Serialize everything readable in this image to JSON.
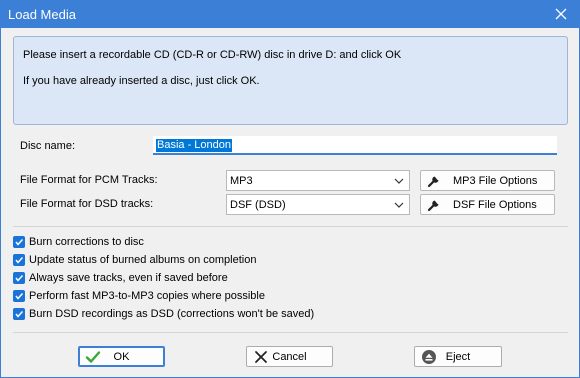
{
  "window": {
    "title": "Load Media",
    "accent_color": "#3b7fd6"
  },
  "info": {
    "line1": "Please insert a recordable CD (CD-R or CD-RW) disc in drive D: and click OK",
    "line2": "If you have already inserted a disc, just click OK."
  },
  "disc": {
    "label": "Disc name:",
    "value": "Basia - London"
  },
  "pcm": {
    "label": "File Format for PCM Tracks:",
    "selected": "MP3",
    "options_button": "MP3 File Options"
  },
  "dsd": {
    "label": "File Format for DSD tracks:",
    "selected": "DSF (DSD)",
    "options_button": "DSF File Options"
  },
  "checkboxes": [
    {
      "label": "Burn corrections to disc",
      "checked": true
    },
    {
      "label": "Update status of burned albums on completion",
      "checked": true
    },
    {
      "label": "Always save tracks, even if saved before",
      "checked": true
    },
    {
      "label": "Perform fast MP3-to-MP3 copies where possible",
      "checked": true
    },
    {
      "label": "Burn DSD recordings as DSD (corrections won't be saved)",
      "checked": true
    }
  ],
  "buttons": {
    "ok": "OK",
    "cancel": "Cancel",
    "eject": "Eject"
  },
  "icons": {
    "close": "close-icon",
    "wrench": "wrench-icon",
    "check": "checkmark-icon",
    "cancel": "x-icon",
    "eject": "eject-icon"
  }
}
